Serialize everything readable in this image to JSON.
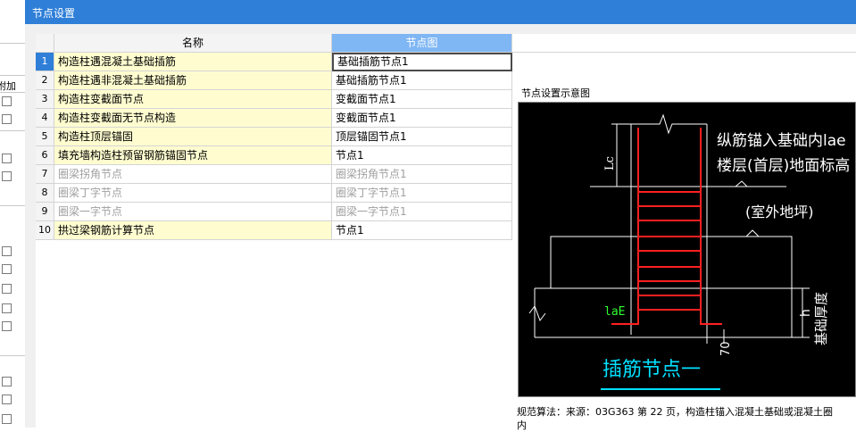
{
  "dialog": {
    "title": "节点设置"
  },
  "background": {
    "header_fragment": "附加"
  },
  "table": {
    "headers": {
      "name": "名称",
      "node": "节点图"
    },
    "rows": [
      {
        "num": "1",
        "name": "构造柱遇混凝土基础插筋",
        "node": "基础插筋节点1"
      },
      {
        "num": "2",
        "name": "构造柱遇非混凝土基础插筋",
        "node": "基础插筋节点1"
      },
      {
        "num": "3",
        "name": "构造柱变截面节点",
        "node": "变截面节点1"
      },
      {
        "num": "4",
        "name": "构造柱变截面无节点构造",
        "node": "变截面节点1"
      },
      {
        "num": "5",
        "name": "构造柱顶层锚固",
        "node": "顶层锚固节点1"
      },
      {
        "num": "6",
        "name": "填充墙构造柱预留钢筋锚固节点",
        "node": "节点1"
      },
      {
        "num": "7",
        "name": "圈梁拐角节点",
        "node": "圈梁拐角节点1"
      },
      {
        "num": "8",
        "name": "圈梁丁字节点",
        "node": "圈梁丁字节点1"
      },
      {
        "num": "9",
        "name": "圈梁一字节点",
        "node": "圈梁一字节点1"
      },
      {
        "num": "10",
        "name": "拱过梁钢筋计算节点",
        "node": "节点1"
      }
    ]
  },
  "preview": {
    "title": "节点设置示意图",
    "diagram": {
      "label_anchor": "纵筋锚入基础内lae",
      "label_floor": "楼层(首层)地面标高",
      "label_outdoor": "(室外地坪)",
      "label_lc": "Lc",
      "label_lae": "laE",
      "label_h": "h",
      "label_depth": "基础厚度",
      "label_70": "70",
      "caption": "插筋节点一"
    },
    "description_line1": "规范算法：来源：03G363 第 22 页，构造柱锚入混凝土基础或混凝土圈",
    "description_line2": "内"
  }
}
